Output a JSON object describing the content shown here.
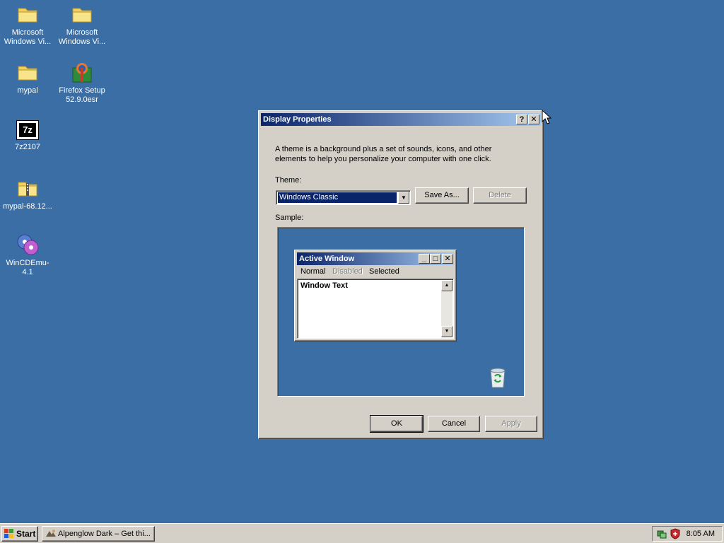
{
  "desktop": {
    "background_color": "#3a6ea5",
    "icons": [
      {
        "icon": "folder-icon",
        "label": "Microsoft\nWindows Vi..."
      },
      {
        "icon": "folder-icon",
        "label": "Microsoft\nWindows Vi..."
      },
      {
        "icon": "folder-icon",
        "label": "mypal"
      },
      {
        "icon": "firefox-installer-icon",
        "label": "Firefox Setup\n52.9.0esr"
      },
      {
        "icon": "7zip-icon",
        "label": "7z2107",
        "icon_text": "7z"
      },
      {
        "icon": "zip-folder-icon",
        "label": "mypal-68.12..."
      },
      {
        "icon": "cd-emulator-icon",
        "label": "WinCDEmu-4.1"
      }
    ]
  },
  "dialog": {
    "title": "Display Properties",
    "help_glyph": "?",
    "close_glyph": "✕",
    "description": "A theme is a background plus a set of sounds, icons, and other elements to help you personalize your computer with one click.",
    "theme_label": "Theme:",
    "theme_value": "Windows Classic",
    "save_as_label": "Save As...",
    "delete_label": "Delete",
    "sample_label": "Sample:",
    "sample": {
      "window_title": "Active Window",
      "menu": {
        "normal": "Normal",
        "disabled": "Disabled",
        "selected": "Selected"
      },
      "window_text": "Window Text",
      "min_glyph": "_",
      "max_glyph": "□",
      "close_glyph": "✕"
    },
    "ok_label": "OK",
    "cancel_label": "Cancel",
    "apply_label": "Apply"
  },
  "taskbar": {
    "start_label": "Start",
    "task_label": "Alpenglow Dark – Get thi...",
    "clock": "8:05 AM"
  },
  "colors": {
    "titlebar_start": "#0a246a",
    "titlebar_end": "#a6caf0",
    "face": "#d4d0c8"
  }
}
